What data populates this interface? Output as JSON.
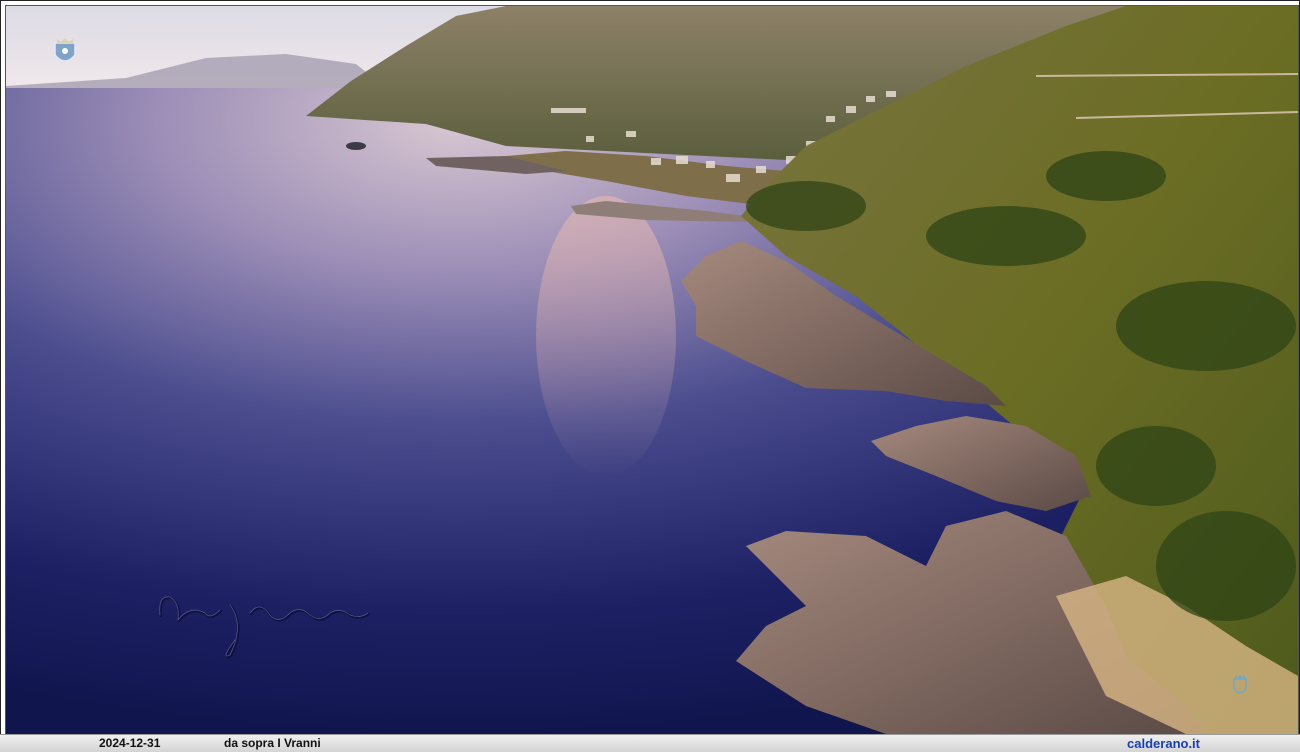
{
  "caption": {
    "date": "2024-12-31",
    "title": "da sopra I Vranni",
    "site": "calderano.it"
  },
  "watermarks": {
    "top_left": "crest-emblem-icon",
    "bottom_right": "crest-emblem-icon",
    "signature": "handwritten-signature"
  },
  "colors": {
    "sea_deep": "#14185a",
    "sea_light": "#b6a9c7",
    "sky": "#e9e6ef",
    "hill_green": "#5c6a22",
    "rock": "#8a7468",
    "caption_link": "#1a3fb0"
  }
}
